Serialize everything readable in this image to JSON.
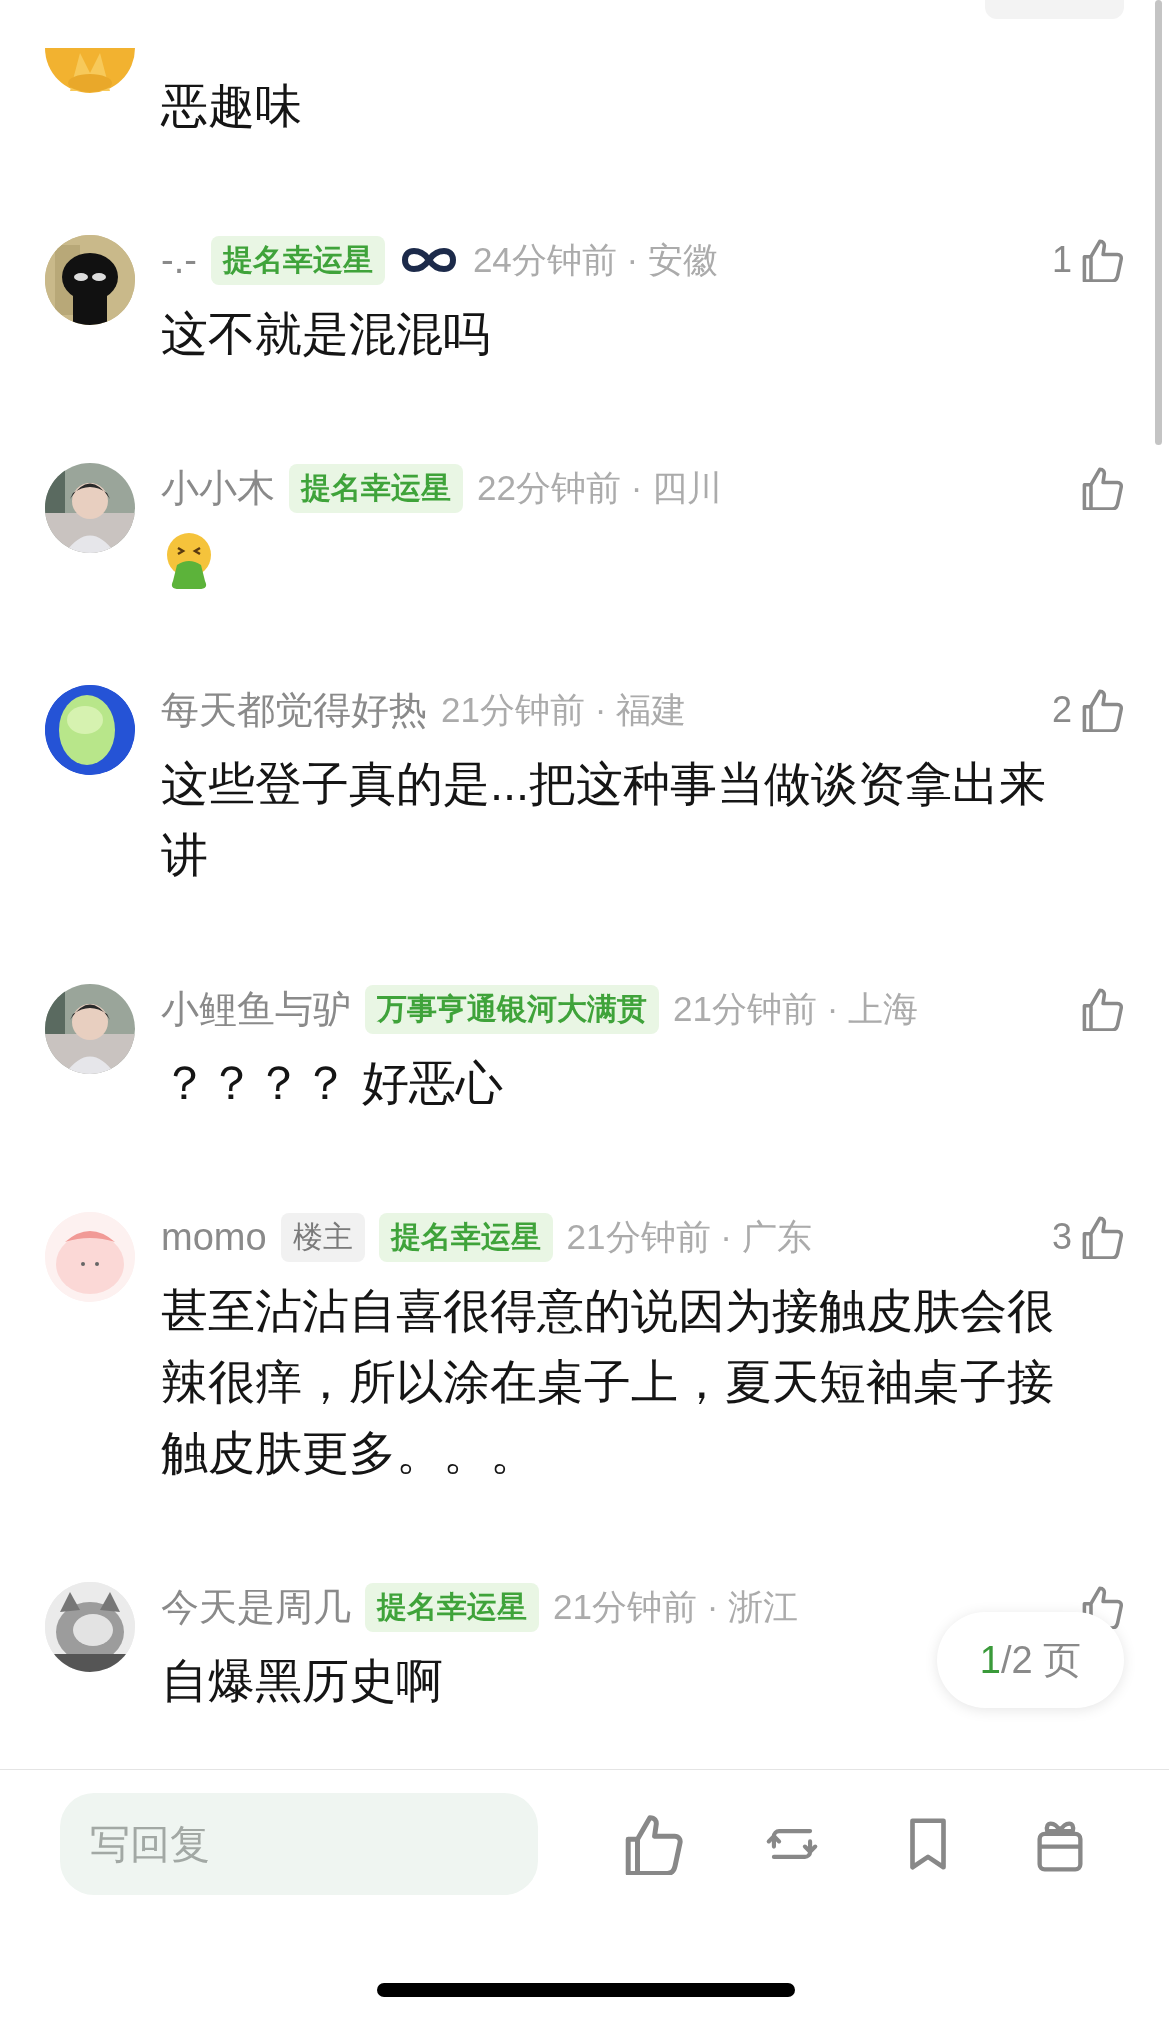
{
  "comments": [
    {
      "content": {
        "kind": "text",
        "text": "恶趣味"
      }
    },
    {
      "name": "-.-",
      "badges": [
        {
          "kind": "tag",
          "label": "提名幸运星"
        }
      ],
      "vip": true,
      "meta": "24分钟前 · 安徽",
      "likes": "1",
      "content": {
        "kind": "text",
        "text": "这不就是混混吗"
      }
    },
    {
      "name": "小小木",
      "badges": [
        {
          "kind": "tag",
          "label": "提名幸运星"
        }
      ],
      "vip": false,
      "meta": "22分钟前 · 四川",
      "content": {
        "kind": "emoji"
      }
    },
    {
      "name": "每天都觉得好热",
      "vip": false,
      "meta": "21分钟前 · 福建",
      "likes": "2",
      "content": {
        "kind": "text",
        "text": "这些登子真的是...把这种事当做谈资拿出来讲"
      }
    },
    {
      "name": "小鲤鱼与驴",
      "badges": [
        {
          "kind": "tag",
          "label": "万事亨通银河大满贯"
        }
      ],
      "vip": false,
      "meta": "21分钟前 · 上海",
      "content": {
        "kind": "text",
        "text": "？？？？ 好恶心"
      }
    },
    {
      "name": "momo",
      "badges": [
        {
          "kind": "owner",
          "label": "楼主"
        },
        {
          "kind": "tag",
          "label": "提名幸运星"
        }
      ],
      "vip": false,
      "meta": "21分钟前 · 广东",
      "likes": "3",
      "content": {
        "kind": "text",
        "text": "甚至沾沾自喜很得意的说因为接触皮肤会很辣很痒，所以涂在桌子上，夏天短袖桌子接触皮肤更多。。。"
      }
    },
    {
      "name": "今天是周几",
      "badges": [
        {
          "kind": "tag",
          "label": "提名幸运星"
        }
      ],
      "vip": false,
      "meta": "21分钟前 · 浙江",
      "content": {
        "kind": "text",
        "text": "自爆黑历史啊"
      }
    }
  ],
  "pager": {
    "current": "1",
    "rest": "/2 页"
  },
  "reply_field": {
    "placeholder": "写回复"
  }
}
